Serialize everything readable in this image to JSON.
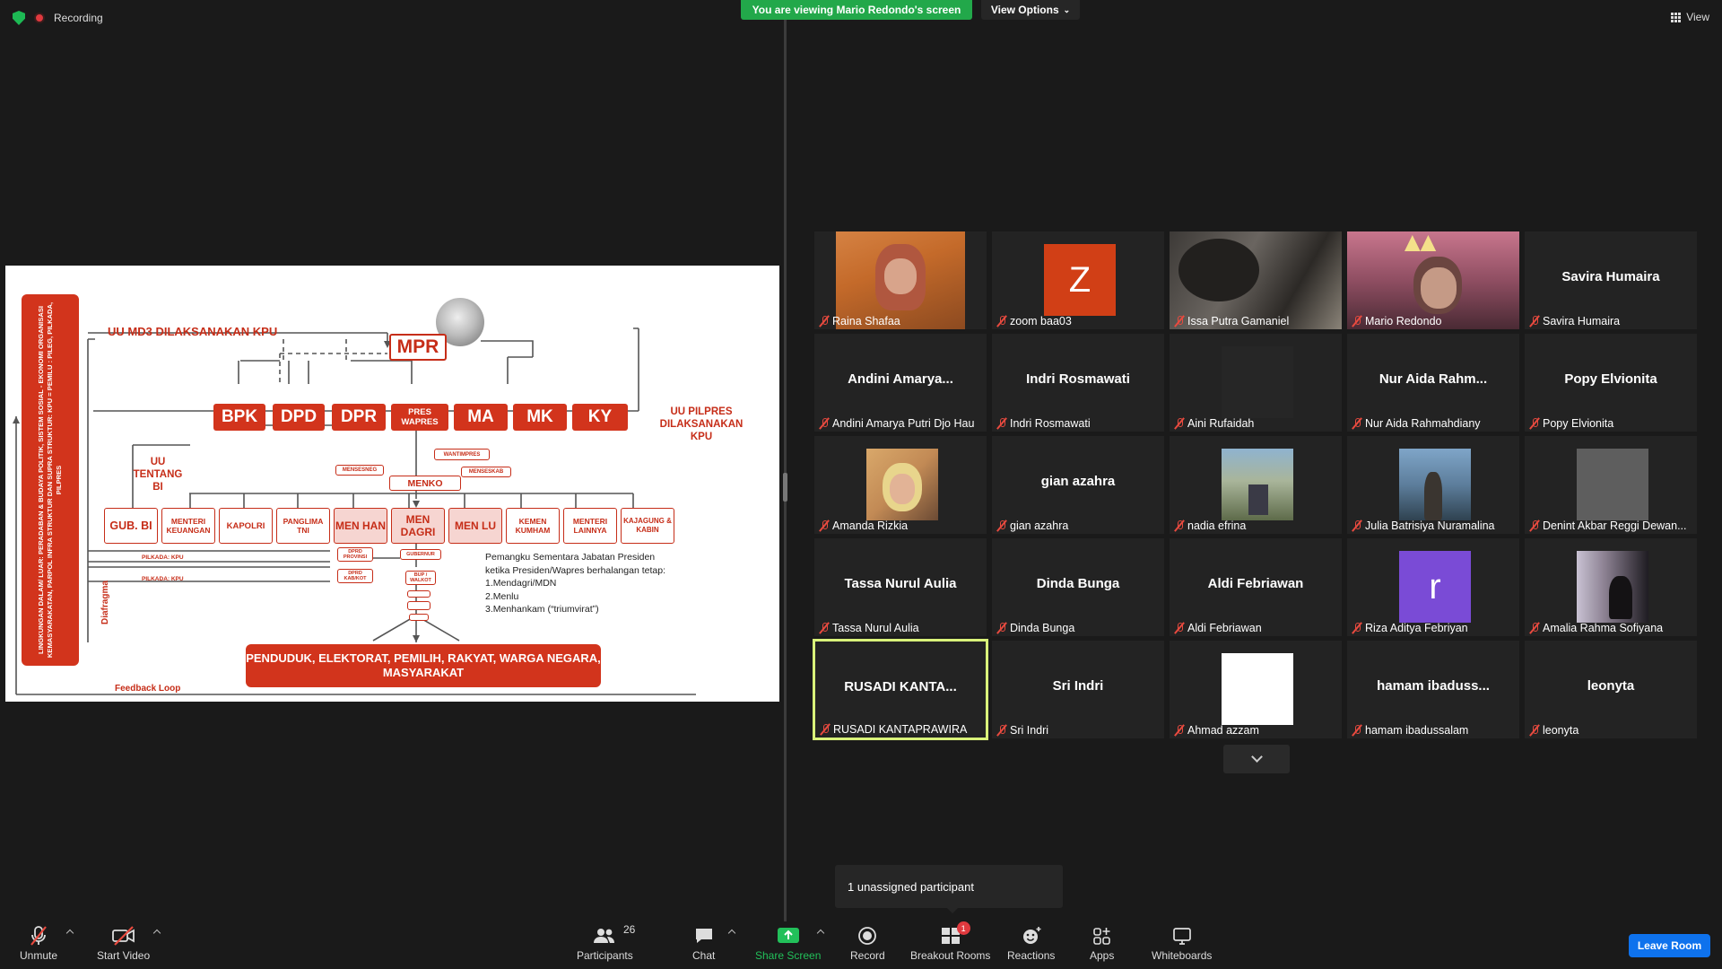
{
  "top": {
    "recording": "Recording",
    "viewing": "You are viewing Mario Redondo's screen",
    "view_options": "View Options",
    "view": "View"
  },
  "slide": {
    "left_bar": "LINGKUNGAN DALAM/ LUAR: PERADABAN & BUDAYA POLITIK, SISTEM SOSIAL - EKONOMI ORGANISASI KEMASYARAKATAN, PARPOL INFRA STRUKTUR DAN SUPRA STRUKTUR: KPU = PEMILU : PILEG, PILKADA, PILPRES",
    "diafragma": "Diafragma",
    "feedback": "Feedback Loop",
    "uu_md3": "UU MD3 DILAKSANAKAN KPU",
    "uu_pilpres": "UU PILPRES DILAKSANAKAN KPU",
    "uu_bi": "UU TENTANG BI",
    "mpr": "MPR",
    "row1": [
      "BPK",
      "DPD",
      "DPR",
      "PRES WAPRES",
      "MA",
      "MK",
      "KY"
    ],
    "wantimpres": "WANTIMPRES",
    "mensesneg": "MENSESNEG",
    "menseskab": "MENSESKAB",
    "menko": "MENKO",
    "row2": [
      "GUB. BI",
      "MENTERI KEUANGAN",
      "KAPOLRI",
      "PANGLIMA TNI",
      "MEN HAN",
      "MEN DAGRI",
      "MEN LU",
      "KEMEN KUMHAM",
      "MENTERI LAINNYA",
      "KAJAGUNG & KABIN"
    ],
    "pilkada1": "PILKADA: KPU",
    "pilkada2": "PILKADA: KPU",
    "dprd_prov": "DPRD PROVINSI",
    "dprd_kab": "DPRD KAB/KOT",
    "gubernur": "GUBERNUR",
    "bup": "BUP / WALKOT",
    "note_title": "Pemangku Sementara Jabatan Presiden",
    "note_sub": "ketika Presiden/Wapres berhalangan tetap:",
    "note_items": [
      "1.Mendagri/MDN",
      "2.Menlu",
      "3.Menhankam (“triumvirat”)"
    ],
    "people": "PENDUDUK, ELEKTORAT, PEMILIH, RAKYAT, WARGA NEGARA, MASYARAKAT"
  },
  "participants": [
    {
      "name": "Raina Shafaa",
      "big": ""
    },
    {
      "name": "zoom baa03",
      "big": "Z"
    },
    {
      "name": "Issa Putra Gamaniel",
      "big": ""
    },
    {
      "name": "Mario Redondo",
      "big": ""
    },
    {
      "name": "Savira Humaira",
      "big": "Savira Humaira"
    },
    {
      "name": "Andini Amarya Putri Djo Hau",
      "big": "Andini  Amarya..."
    },
    {
      "name": "Indri Rosmawati",
      "big": "Indri Rosmawati"
    },
    {
      "name": "Aini Rufaidah",
      "big": ""
    },
    {
      "name": "Nur Aida Rahmahdiany",
      "big": "Nur Aida Rahm..."
    },
    {
      "name": "Popy Elvionita",
      "big": "Popy Elvionita"
    },
    {
      "name": "Amanda Rizkia",
      "big": ""
    },
    {
      "name": "gian azahra",
      "big": "gian azahra"
    },
    {
      "name": "nadia efrina",
      "big": ""
    },
    {
      "name": "Julia Batrisiya Nuramalina",
      "big": ""
    },
    {
      "name": "Denint Akbar Reggi Dewan...",
      "big": ""
    },
    {
      "name": "Tassa Nurul Aulia",
      "big": "Tassa Nurul Aulia"
    },
    {
      "name": "Dinda Bunga",
      "big": "Dinda Bunga"
    },
    {
      "name": "Aldi Febriawan",
      "big": "Aldi Febriawan"
    },
    {
      "name": "Riza Aditya Febriyan",
      "big": "r"
    },
    {
      "name": "Amalia Rahma Sofiyana",
      "big": ""
    },
    {
      "name": "RUSADI KANTAPRAWIRA",
      "big": "RUSADI  KANTA..."
    },
    {
      "name": "Sri Indri",
      "big": "Sri Indri"
    },
    {
      "name": "Ahmad azzam",
      "big": ""
    },
    {
      "name": "hamam ibadussalam",
      "big": "hamam  ibaduss..."
    },
    {
      "name": "leonyta",
      "big": "leonyta"
    }
  ],
  "popup": "1 unassigned participant",
  "toolbar": {
    "unmute": "Unmute",
    "start_video": "Start Video",
    "participants": "Participants",
    "participants_count": "26",
    "chat": "Chat",
    "share": "Share Screen",
    "record": "Record",
    "breakout": "Breakout Rooms",
    "breakout_badge": "1",
    "reactions": "Reactions",
    "apps": "Apps",
    "whiteboards": "Whiteboards",
    "leave": "Leave Room"
  },
  "colors": {
    "accent_green": "#22a84a",
    "slide_red": "#d2341c",
    "leave_blue": "#0e72ed",
    "active_border": "#d9f27a",
    "mute_red": "#e94a3f"
  }
}
